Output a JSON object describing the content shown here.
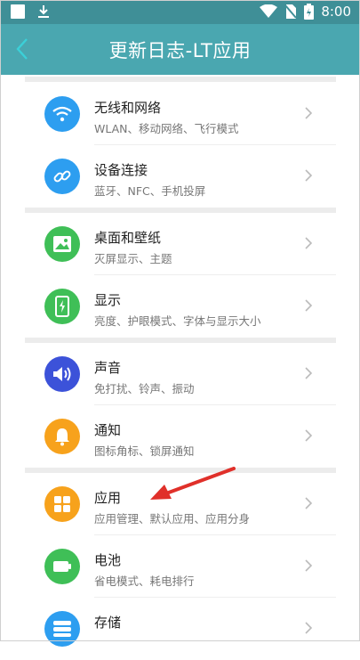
{
  "status_bar": {
    "time": "8:00",
    "icons": [
      "square-icon",
      "download-icon",
      "wifi-icon",
      "no-sim-icon",
      "battery-icon"
    ]
  },
  "header": {
    "title": "更新日志-LT应用",
    "back_icon": "back-chevron-icon"
  },
  "colors": {
    "status_bar": "#3f8f97",
    "title_bar": "#4aa7b0",
    "blue": "#2d9ef0",
    "green": "#3fbf57",
    "indigo": "#3c52d9",
    "orange": "#f7a21c",
    "arrow": "#e0302a"
  },
  "groups": [
    {
      "items": [
        {
          "title": "无线和网络",
          "subtitle": "WLAN、移动网络、飞行模式",
          "icon": "wifi-icon",
          "color": "#2d9ef0"
        },
        {
          "title": "设备连接",
          "subtitle": "蓝牙、NFC、手机投屏",
          "icon": "link-icon",
          "color": "#2d9ef0"
        }
      ]
    },
    {
      "items": [
        {
          "title": "桌面和壁纸",
          "subtitle": "灭屏显示、主题",
          "icon": "image-icon",
          "color": "#3fbf57"
        },
        {
          "title": "显示",
          "subtitle": "亮度、护眼模式、字体与显示大小",
          "icon": "phone-display-icon",
          "color": "#3fbf57"
        }
      ]
    },
    {
      "items": [
        {
          "title": "声音",
          "subtitle": "免打扰、铃声、振动",
          "icon": "speaker-icon",
          "color": "#3c52d9"
        },
        {
          "title": "通知",
          "subtitle": "图标角标、锁屏通知",
          "icon": "bell-icon",
          "color": "#f7a21c"
        }
      ]
    },
    {
      "items": [
        {
          "title": "应用",
          "subtitle": "应用管理、默认应用、应用分身",
          "icon": "apps-grid-icon",
          "color": "#f7a21c"
        },
        {
          "title": "电池",
          "subtitle": "省电模式、耗电排行",
          "icon": "battery-icon",
          "color": "#3fbf57"
        },
        {
          "title": "存储",
          "subtitle": "",
          "icon": "storage-icon",
          "color": "#2d9ef0"
        }
      ]
    }
  ]
}
